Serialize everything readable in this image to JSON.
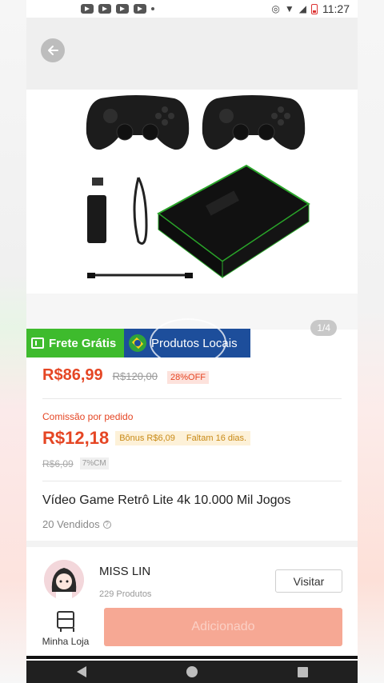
{
  "status_bar": {
    "time": "11:27"
  },
  "gallery": {
    "counter": "1/4"
  },
  "badges": {
    "frete": "Frete Grátis",
    "local": "Produtos Locais"
  },
  "price": {
    "current": "R$86,99",
    "old": "R$120,00",
    "discount": "28%OFF"
  },
  "commission": {
    "label": "Comissão por pedido",
    "value": "R$12,18",
    "bonus": "Bônus R$6,09",
    "remaining": "Faltam 16 dias.",
    "old_value": "R$6,09",
    "rate": "7%CM"
  },
  "product": {
    "title": "Vídeo Game Retrô Lite 4k 10.000 Mil Jogos",
    "sold": "20 Vendidos"
  },
  "shop": {
    "name": "MISS LIN",
    "products": "229 Produtos",
    "visit_label": "Visitar"
  },
  "bottom": {
    "my_store_label": "Minha Loja",
    "add_label": "Adicionado"
  },
  "colors": {
    "accent": "#e54624",
    "frete": "#3ebb2d",
    "local": "#1d4e9b",
    "add_button": "#f6a894"
  },
  "icons": [
    "back-arrow-icon",
    "truck-icon",
    "brazil-flag-icon",
    "question-icon",
    "store-icon",
    "nav-back-icon",
    "nav-home-icon",
    "nav-recent-icon"
  ]
}
